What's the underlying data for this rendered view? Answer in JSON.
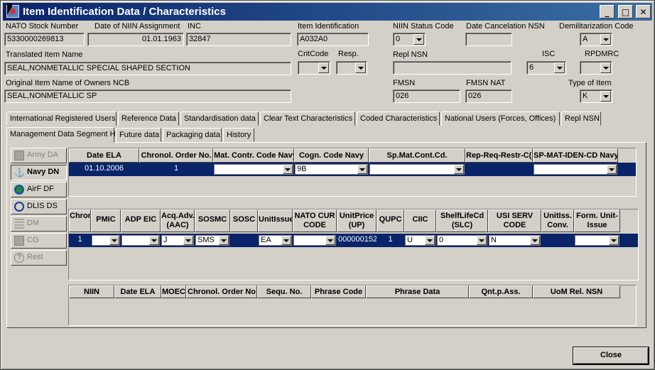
{
  "window": {
    "title": "Item Identification Data / Characteristics",
    "min_label": "_",
    "max_label": "□",
    "close_label": "✕"
  },
  "fields": {
    "nsn_label": "NATO Stock Number",
    "nsn_value": "5330000269813",
    "niin_date_label": "Date of NIIN Assignment",
    "niin_date_value": "01.01.1963",
    "inc_label": "INC",
    "inc_value": "32847",
    "item_id_label": "Item Identification",
    "item_id_value": "A032A0",
    "niin_status_label": "NIIN Status Code",
    "niin_status_value": "0",
    "date_cancel_label": "Date Cancelation NSN",
    "date_cancel_value": "",
    "demil_label": "Demilitarization Code",
    "demil_value": "A",
    "translated_name_label": "Translated Item Name",
    "translated_name_value": "SEAL,NONMETALLIC SPECIAL SHAPED SECTION",
    "critcode_label": "CritCode",
    "critcode_value": "",
    "resp_label": "Resp.",
    "resp_value": "",
    "repl_nsn_label": "Repl NSN",
    "repl_nsn_value": "",
    "isc_label": "ISC",
    "isc_value": "6",
    "rpdmrc_label": "RPDMRC",
    "rpdmrc_value": "",
    "orig_name_label": "Original Item Name of Owners NCB",
    "orig_name_value": "SEAL,NONMETALLIC SP",
    "fmsn_label": "FMSN",
    "fmsn_value": "026",
    "fmsn_nat_label": "FMSN NAT",
    "fmsn_nat_value": "026",
    "type_label": "Type of Item",
    "type_value": "K"
  },
  "tabs_row1": [
    "International Registered Users",
    "Reference Data",
    "Standardisation data",
    "Clear Text Characteristics",
    "Coded Characteristics",
    "National Users (Forces, Offices)",
    "Repl NSN"
  ],
  "tabs_row2": [
    "Management Data Segment H",
    "Future data",
    "Packaging data",
    "History"
  ],
  "side_buttons": [
    "Army DA",
    "Navy DN",
    "AirF DF",
    "DLIS DS",
    "DM",
    "CG",
    "Rest"
  ],
  "grid1": {
    "headers": [
      "Date ELA",
      "Chronol. Order No.",
      "Mat. Contr. Code Navy",
      "Cogn. Code Navy",
      "Sp.Mat.Cont.Cd.",
      "Rep-Req-Restr-C(R)",
      "SP-MAT-IDEN-CD Navy"
    ],
    "row": {
      "date_ela": "01.10.2006",
      "chronol": "1",
      "mat_contr": "",
      "cogn": "9B",
      "sp_mat": "",
      "rep_req": "",
      "sp_mat_iden": ""
    }
  },
  "grid2": {
    "headers": [
      "Chronol. Order",
      "PMIC",
      "ADP EIC",
      "Acq.Adv.Code (AAC)",
      "SOSMC",
      "SOSC",
      "UnitIssueCd",
      "NATO CUR CODE",
      "UnitPrice (UP)",
      "QUPC",
      "CIIC",
      "ShelfLifeCd (SLC)",
      "USI SERV CODE",
      "UnitIss. Conv.",
      "Form. Unit-Issue"
    ],
    "row": {
      "chronol": "1",
      "pmic": "",
      "adp": "",
      "aac": "J",
      "sosmc": "SMS",
      "sosc": "",
      "unit_issue": "EA",
      "nato_cur": "",
      "unit_price": "000000152",
      "qupc": "1",
      "ciic": "U",
      "slc": "0",
      "usi": "N",
      "conv": "",
      "form": ""
    }
  },
  "grid3": {
    "headers": [
      "NIIN",
      "Date ELA",
      "MOEC",
      "Chronol. Order No",
      "Sequ. No.",
      "Phrase Code",
      "Phrase Data",
      "Qnt.p.Ass.",
      "UoM Rel. NSN"
    ]
  },
  "close_label": "Close",
  "colors": {
    "titlebar": "#0a246a",
    "selection": "#0a246a"
  }
}
